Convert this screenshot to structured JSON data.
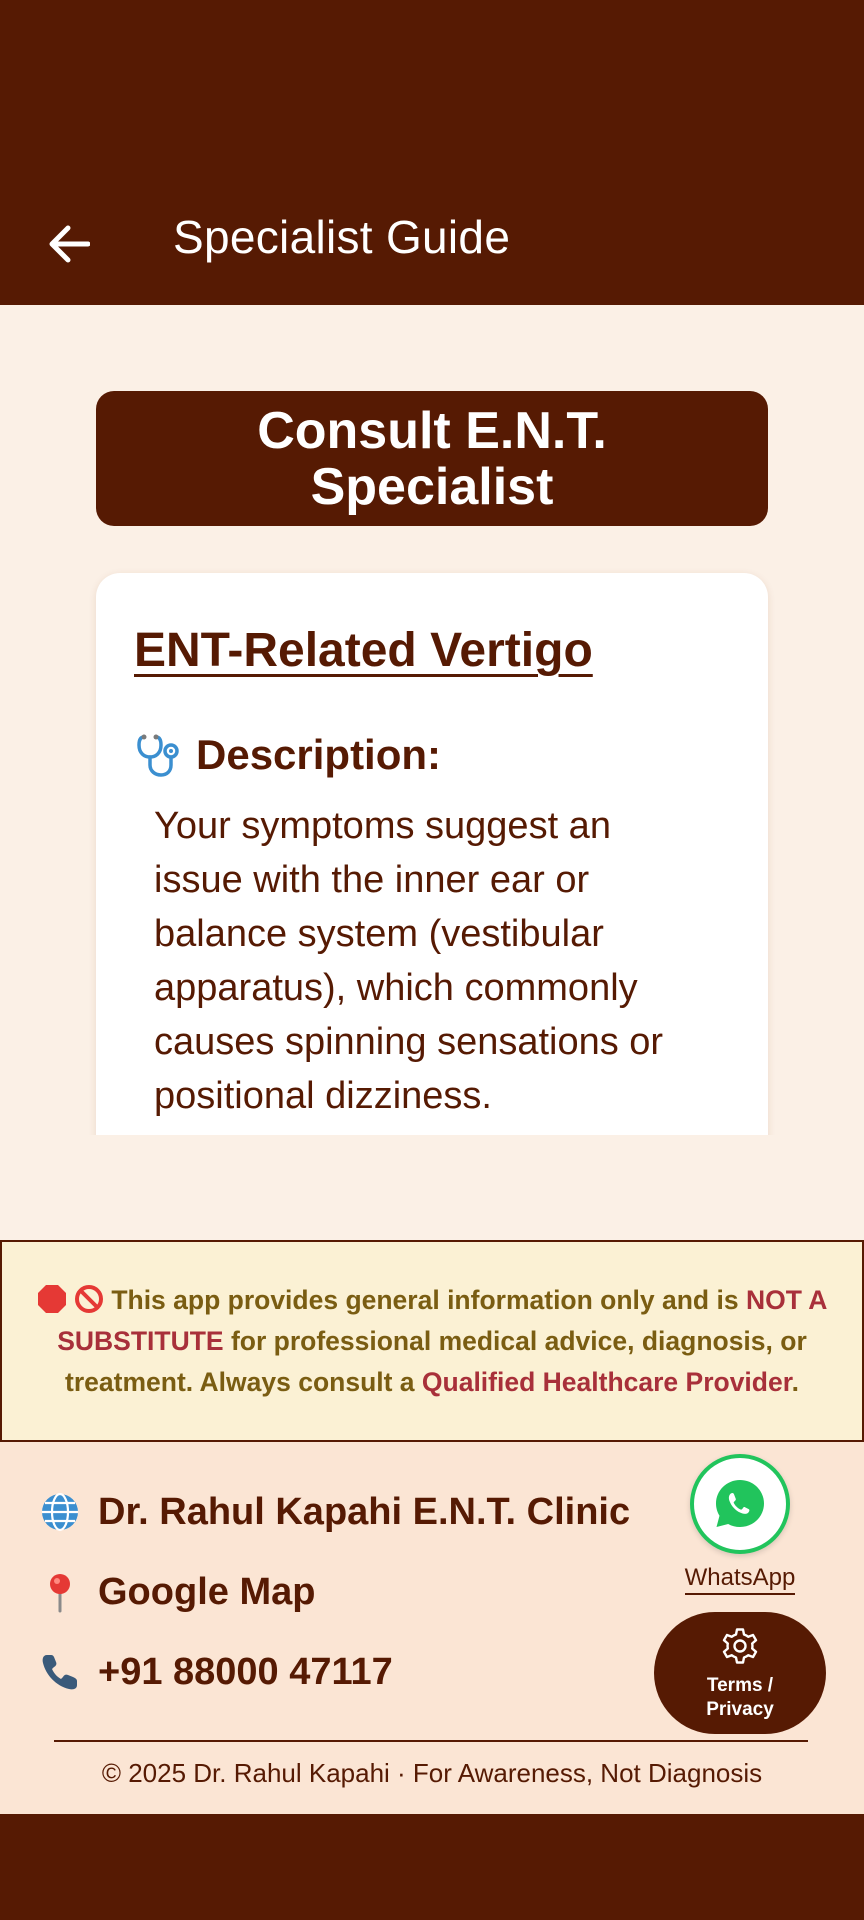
{
  "app_bar": {
    "title": "Specialist Guide",
    "back_icon": "arrow-left-icon"
  },
  "banner": {
    "line1": "Consult E.N.T.",
    "line2": "Specialist"
  },
  "card": {
    "title": "ENT-Related Vertigo",
    "description_heading": "Description:",
    "description_icon": "stethoscope-icon",
    "description_lines": [
      "Your symptoms suggest an",
      "issue with the inner ear or",
      "balance system (vestibular",
      "apparatus), which commonly",
      "causes spinning sensations or",
      "positional dizziness."
    ]
  },
  "disclaimer": {
    "icons": [
      "stop-sign-icon",
      "prohibited-icon"
    ],
    "part1": " This app provides general information only and is ",
    "strong1": "NOT A SUBSTITUTE",
    "part2": " for professional medical advice, diagnosis, or treatment. Always consult a ",
    "strong2": "Qualified Healthcare Provider",
    "part3": "."
  },
  "footer": {
    "clinic_label": "Dr. Rahul Kapahi E.N.T. Clinic",
    "map_label": "Google Map",
    "phone_label": "+91 88000 47117",
    "whatsapp_label": "WhatsApp",
    "terms_line1": "Terms /",
    "terms_line2": "Privacy",
    "copyright": "© 2025 Dr. Rahul Kapahi · For Awareness, Not Diagnosis"
  },
  "colors": {
    "brand": "#561a03",
    "background": "#fbf0e6",
    "disclaimer_bg": "#fbf1d4",
    "disclaimer_text": "#7a5d12",
    "disclaimer_strong": "#a8303a",
    "footer_bg": "#fbe5d4",
    "whatsapp_green": "#21c45c"
  }
}
